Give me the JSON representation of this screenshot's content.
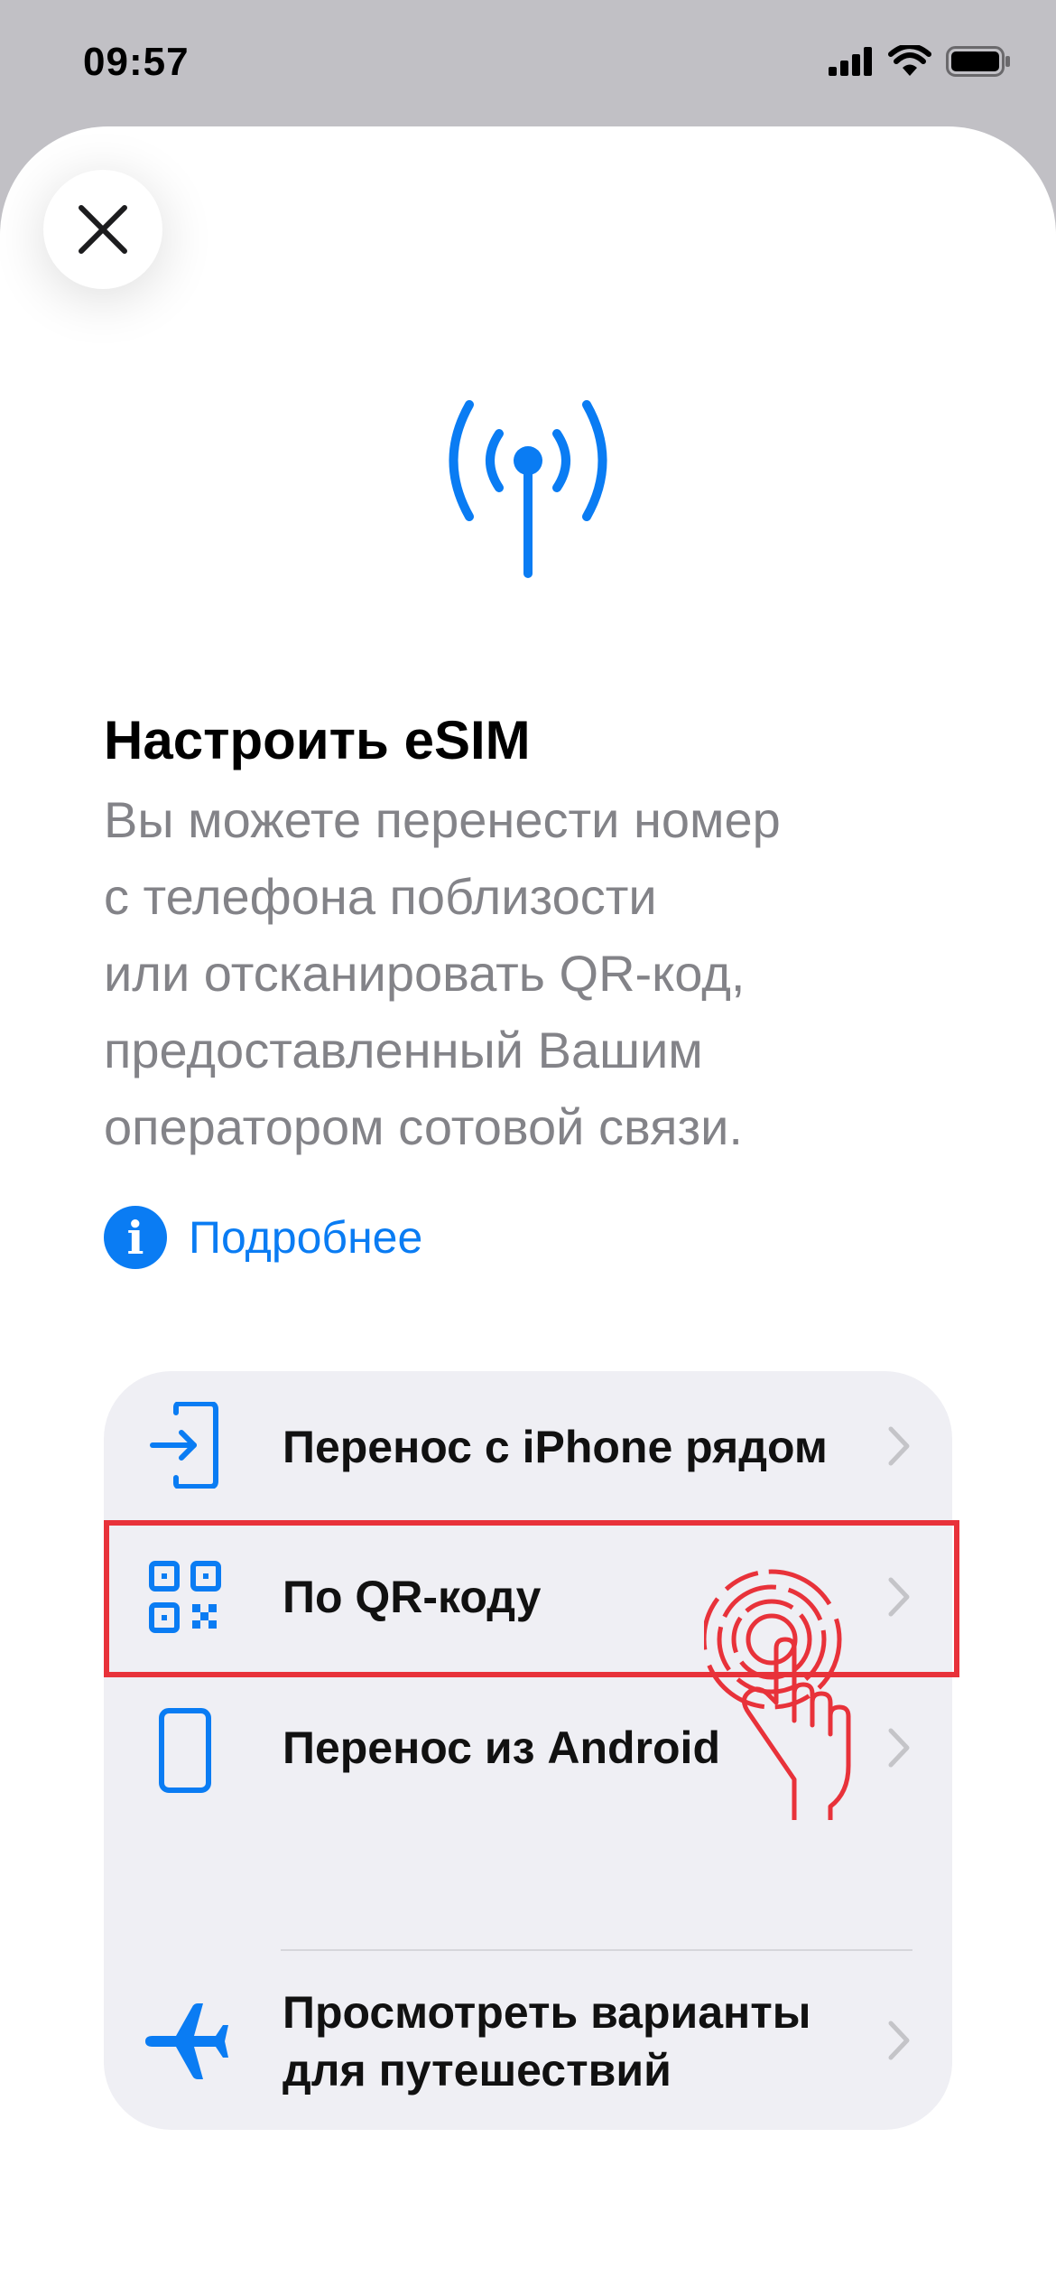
{
  "status_bar": {
    "time": "09:57"
  },
  "screen": {
    "title": "Настроить eSIM",
    "description": "Вы можете перенести номер\nс телефона поблизости\nили отсканировать QR-код,\nпредоставленный Вашим\nоператором сотовой связи.",
    "more_link": "Подробнее",
    "info_icon_glyph": "i"
  },
  "options": [
    {
      "label": "Перенос с iPhone рядом",
      "icon": "transfer-in-icon"
    },
    {
      "label": "По QR-коду",
      "icon": "qr-code-icon"
    },
    {
      "label": "Перенос из Android",
      "icon": "phone-icon"
    },
    {
      "label": "Просмотреть варианты\nдля путешествий",
      "icon": "airplane-icon"
    }
  ],
  "colors": {
    "accent": "#0a7cf3",
    "highlight": "#e8323a",
    "secondary_text": "#838388",
    "card_background": "#efeff4",
    "backdrop": "#c1c0c5"
  }
}
